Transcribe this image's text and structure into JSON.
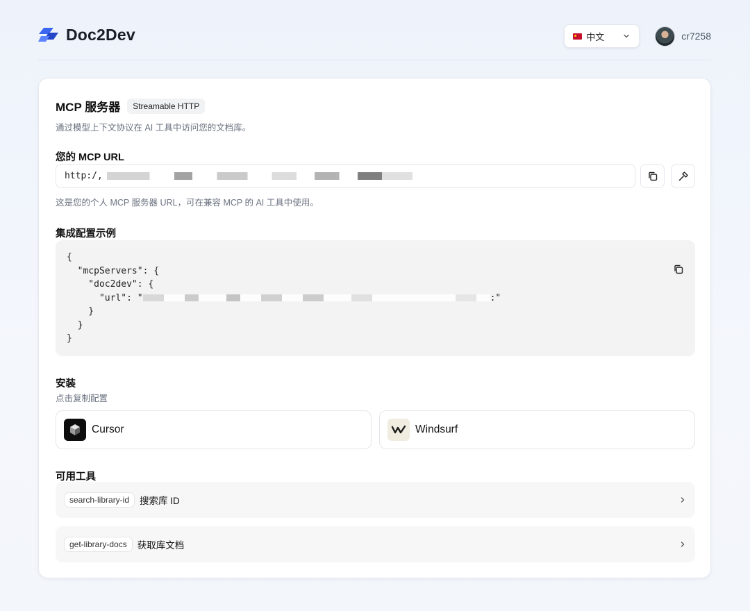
{
  "header": {
    "brand": "Doc2Dev",
    "language": {
      "label": "中文"
    },
    "user": {
      "name": "cr7258"
    }
  },
  "card": {
    "title": "MCP 服务器",
    "badge": "Streamable HTTP",
    "subtitle": "通过模型上下文协议在 AI 工具中访问您的文档库。",
    "url_section": {
      "label": "您的 MCP URL",
      "value": "http:/,",
      "hint": "这是您的个人 MCP 服务器 URL，可在兼容 MCP 的 AI 工具中使用。"
    },
    "config_section": {
      "label": "集成配置示例",
      "lines": [
        "{",
        "  \"mcpServers\": {",
        "    \"doc2dev\": {",
        "      \"url\": \"",
        "    }",
        "  }",
        "}"
      ],
      "url_end": ":\""
    },
    "install_section": {
      "label": "安装",
      "subtitle": "点击复制配置",
      "apps": [
        {
          "name": "Cursor",
          "icon": "cursor-logo-icon"
        },
        {
          "name": "Windsurf",
          "icon": "windsurf-logo-icon"
        }
      ]
    },
    "tools_section": {
      "label": "可用工具",
      "tools": [
        {
          "tag": "search-library-id",
          "desc": "搜索库 ID"
        },
        {
          "tag": "get-library-docs",
          "desc": "获取库文档"
        }
      ]
    }
  },
  "colors": {
    "brand_blue": "#2f5bea",
    "page_bg": "#eef3fb",
    "code_bg": "#f3f3f3"
  }
}
